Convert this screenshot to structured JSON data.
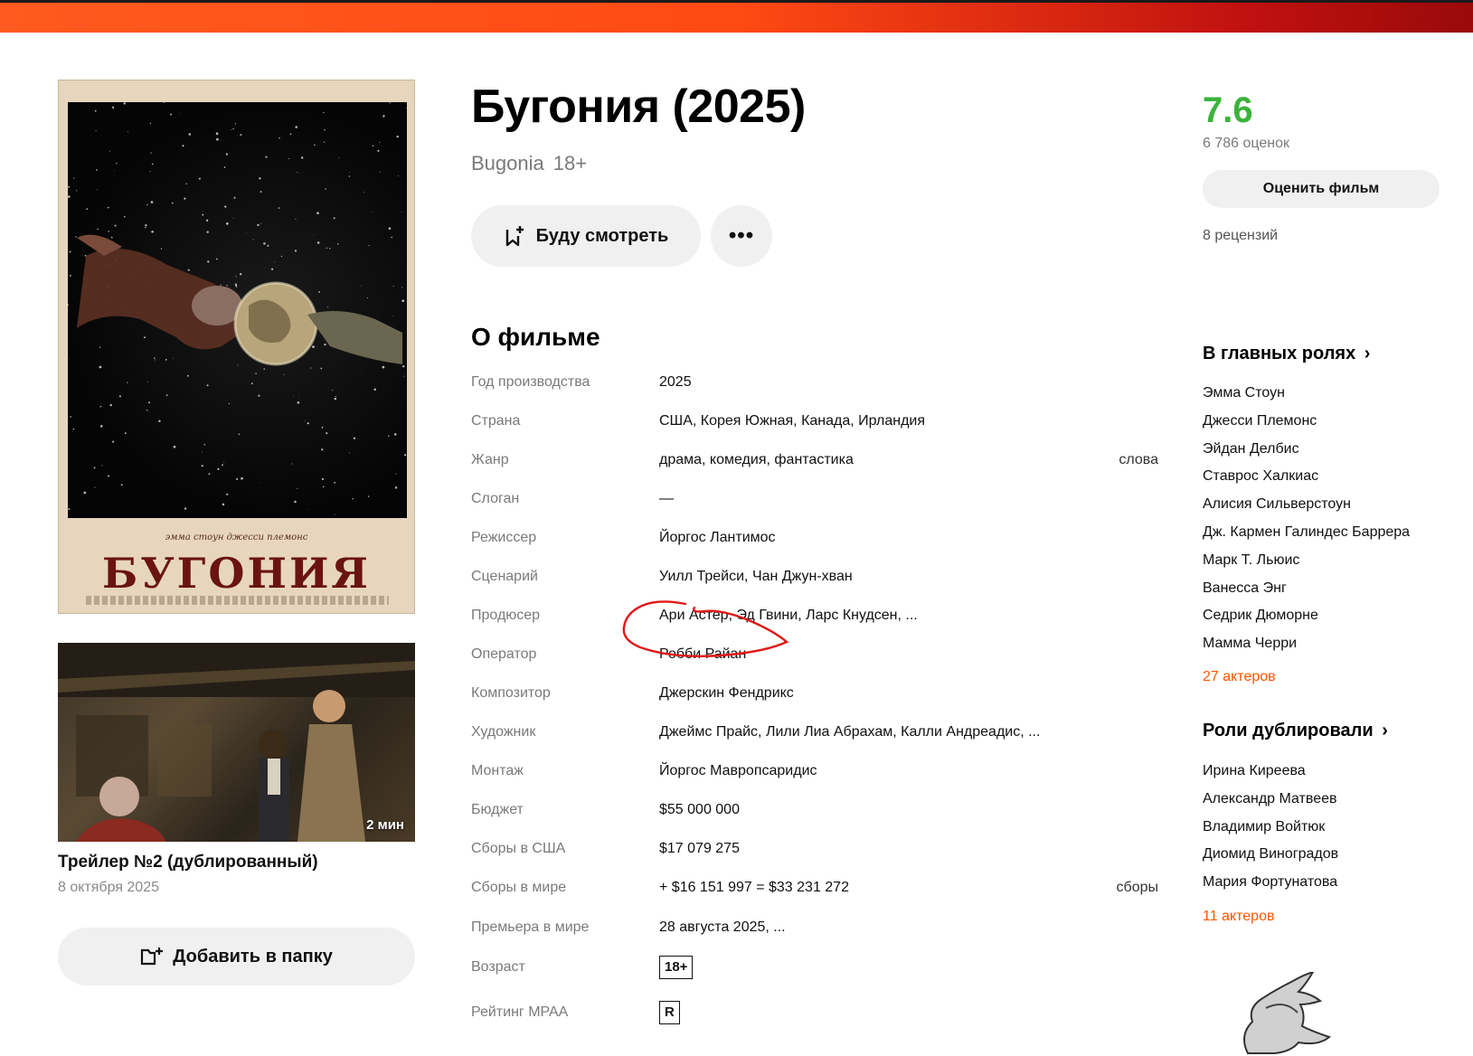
{
  "colors": {
    "accent": "#ff5500",
    "rating": "#3bb33b",
    "label": "#7a7a7a",
    "button_bg": "#f0f0f0"
  },
  "poster": {
    "credits": "эмма стоун   джесси племонс",
    "title": "БУГОНИЯ"
  },
  "trailer": {
    "duration": "2 мин",
    "title": "Трейлер №2 (дублированный)",
    "date": "8 октября 2025"
  },
  "add_folder_label": "Добавить в папку",
  "film": {
    "title": "Бугония (2025)",
    "original_title": "Bugonia",
    "age": "18+"
  },
  "actions": {
    "watch_label": "Буду смотреть",
    "more_label": "•••"
  },
  "about": {
    "heading": "О фильме",
    "rows": [
      {
        "label": "Год производства",
        "value": "2025",
        "extra": ""
      },
      {
        "label": "Страна",
        "value": "США, Корея Южная, Канада, Ирландия",
        "extra": ""
      },
      {
        "label": "Жанр",
        "value": "драма, комедия, фантастика",
        "extra": "слова"
      },
      {
        "label": "Слоган",
        "value": "—",
        "extra": ""
      },
      {
        "label": "Режиссер",
        "value": "Йоргос Лантимос",
        "extra": ""
      },
      {
        "label": "Сценарий",
        "value": "Уилл Трейси, Чан Джун-хван",
        "extra": ""
      },
      {
        "label": "Продюсер",
        "value": "Ари Астер, Эд Гвини, Ларс Кнудсен, ...",
        "extra": ""
      },
      {
        "label": "Оператор",
        "value": "Робби Райан",
        "extra": ""
      },
      {
        "label": "Композитор",
        "value": "Джерскин Фендрикс",
        "extra": ""
      },
      {
        "label": "Художник",
        "value": "Джеймс Прайс, Лили Лиа Абрахам, Калли Андреадис, ...",
        "extra": ""
      },
      {
        "label": "Монтаж",
        "value": "Йоргос Мавропсаридис",
        "extra": ""
      },
      {
        "label": "Бюджет",
        "value": "$55 000 000",
        "extra": ""
      },
      {
        "label": "Сборы в США",
        "value": "$17 079 275",
        "extra": ""
      },
      {
        "label": "Сборы в мире",
        "value": "+ $16 151 997 = $33 231 272",
        "extra": "сборы"
      },
      {
        "label": "Премьера в мире",
        "value": "28 августа 2025, ...",
        "extra": ""
      },
      {
        "label": "Возраст",
        "value": "18+",
        "extra": ""
      },
      {
        "label": "Рейтинг MPAA",
        "value": "R",
        "extra": ""
      }
    ]
  },
  "rating": {
    "value": "7.6",
    "votes": "6 786 оценок",
    "rate_label": "Оценить фильм",
    "reviews": "8 рецензий"
  },
  "cast": {
    "heading": "В главных ролях",
    "people": [
      "Эмма Стоун",
      "Джесси Племонс",
      "Эйдан Делбис",
      "Ставрос Халкиас",
      "Алисия Сильверстоун",
      "Дж. Кармен Галиндес Баррера",
      "Марк Т. Льюис",
      "Ванесса Энг",
      "Седрик Дюморне",
      "Мамма Черри"
    ],
    "count": "27 актеров"
  },
  "dubbing": {
    "heading": "Роли дублировали",
    "people": [
      "Ирина Киреева",
      "Александр Матвеев",
      "Владимир Войтюк",
      "Диомид Виноградов",
      "Мария Фортунатова"
    ],
    "count": "11 актеров"
  }
}
